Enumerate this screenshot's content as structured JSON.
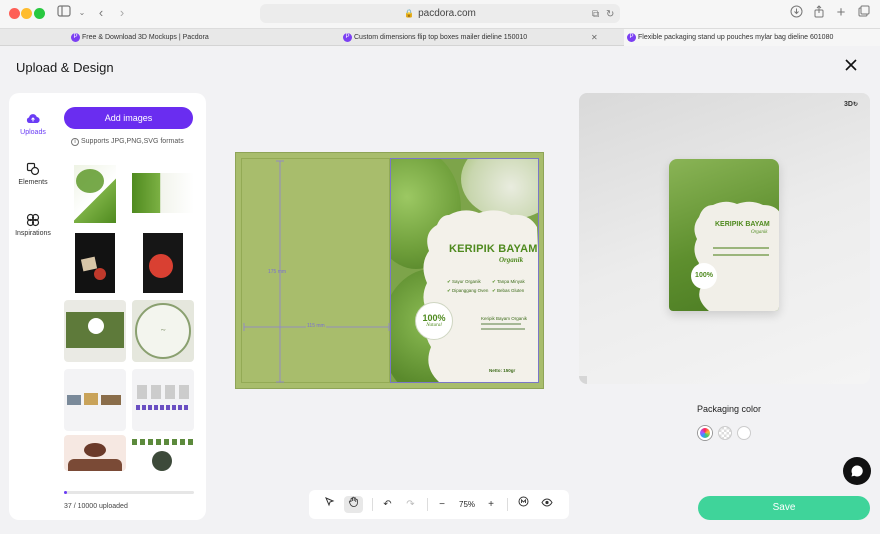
{
  "browser": {
    "url": "pacdora.com",
    "tabs": [
      {
        "label": "Free & Download 3D Mockups | Pacdora"
      },
      {
        "label": "Custom dimensions flip top boxes mailer dieline 150010"
      },
      {
        "label": "Flexible packaging stand up pouches mylar bag dieline 601080"
      }
    ]
  },
  "app": {
    "title": "Upload & Design"
  },
  "sidebar": {
    "nav": [
      {
        "label": "Uploads",
        "icon": "cloud-upload-icon",
        "active": true
      },
      {
        "label": "Elements",
        "icon": "shapes-icon",
        "active": false
      },
      {
        "label": "Inspirations",
        "icon": "flower-icon",
        "active": false
      }
    ],
    "add_images_label": "Add images",
    "supports_text": "Supports JPG,PNG,SVG formats",
    "upload_count": "37 / 10000 uploaded"
  },
  "dieline": {
    "height_dim": "175 mm",
    "width_dim": "115 mm",
    "design": {
      "brand": "KERIPIK BAYAM",
      "subtitle": "Organik",
      "features": [
        "Sayur Organik",
        "Tanpa Minyak",
        "Dipanggang Oven",
        "Bebas Gluten"
      ],
      "badge_main": "100%",
      "badge_sub": "Natural",
      "company": "Keripik Bayam Organik",
      "netto": "Netto: 150gr"
    }
  },
  "toolbar": {
    "zoom": "75%"
  },
  "preview": {
    "badge": "3D",
    "brand": "KERIPIK BAYAM",
    "subtitle": "Organik",
    "badge_main": "100%"
  },
  "packaging": {
    "label": "Packaging color",
    "swatches": [
      "multicolor",
      "transparent",
      "#ffffff"
    ]
  },
  "save_label": "Save",
  "colors": {
    "accent": "#6a2df0",
    "save": "#3fd49a",
    "dieline": "#a8bd6c",
    "brand_green": "#4f8a1f"
  }
}
